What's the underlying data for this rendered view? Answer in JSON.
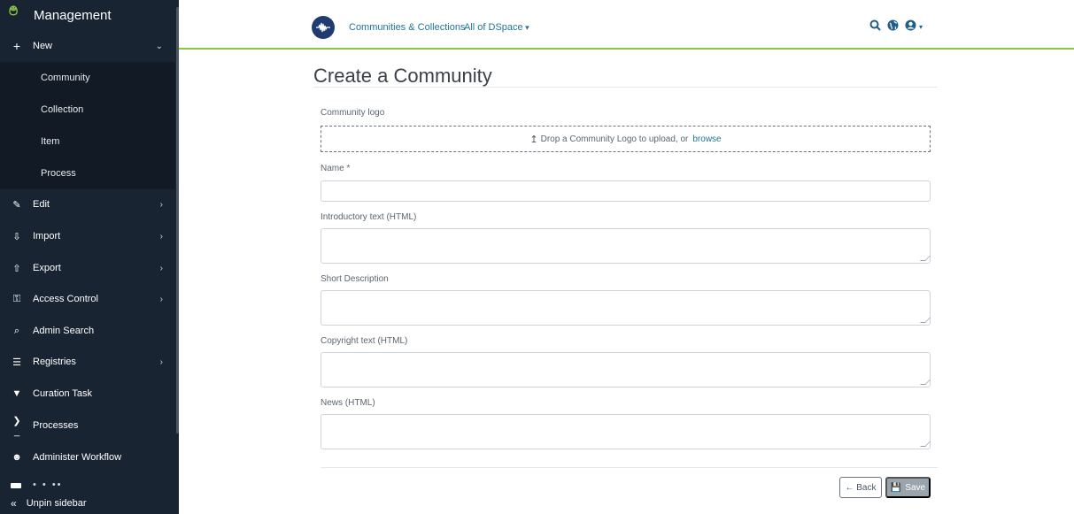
{
  "sidebar": {
    "title": "Management",
    "logo_glyph": "࿉",
    "new": {
      "label": "New",
      "icon": "plus-icon",
      "glyph": "+"
    },
    "new_items": [
      "Community",
      "Collection",
      "Item",
      "Process"
    ],
    "items": [
      {
        "label": "Edit",
        "icon": "pencil-icon",
        "glyph": "✎",
        "has_chevron": true
      },
      {
        "label": "Import",
        "icon": "import-icon",
        "glyph": "⇩",
        "has_chevron": true
      },
      {
        "label": "Export",
        "icon": "export-icon",
        "glyph": "⇧",
        "has_chevron": true
      },
      {
        "label": "Access Control",
        "icon": "key-icon",
        "glyph": "⚿",
        "has_chevron": true
      },
      {
        "label": "Admin Search",
        "icon": "search-icon",
        "glyph": "⌕",
        "has_chevron": false
      },
      {
        "label": "Registries",
        "icon": "list-icon",
        "glyph": "☰",
        "has_chevron": true
      },
      {
        "label": "Curation Task",
        "icon": "filter-icon",
        "glyph": "▼",
        "has_chevron": false
      },
      {
        "label": "Processes",
        "icon": "terminal-icon",
        "glyph": "❯_",
        "has_chevron": false
      },
      {
        "label": "Administer Workflow",
        "icon": "user-check-icon",
        "glyph": "☻",
        "has_chevron": false
      }
    ],
    "unpin": {
      "label": "Unpin sidebar",
      "glyph": "«"
    }
  },
  "header": {
    "nav": [
      "Communities & Collections",
      "All of DSpace"
    ]
  },
  "form": {
    "title": "Create a Community",
    "logo_label": "Community logo",
    "drop_text": "Drop a Community Logo to upload, or",
    "browse": "browse",
    "name_label": "Name *",
    "intro_label": "Introductory text (HTML)",
    "short_desc_label": "Short Description",
    "copyright_label": "Copyright text (HTML)",
    "news_label": "News (HTML)",
    "back": "← Back",
    "save": "Save"
  },
  "colors": {
    "sidebar_bg": "#192433",
    "accent_green": "#8cc63f",
    "link_blue": "#207698"
  }
}
